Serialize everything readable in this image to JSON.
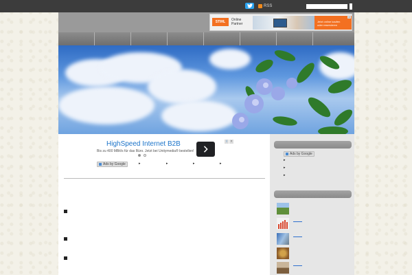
{
  "topbar": {
    "twitter_icon": "twitter-bird-icon",
    "rss_label": "RSS",
    "search_placeholder": "",
    "colors": {
      "bar": "#3c3c3c",
      "twitter": "#2aa3ef",
      "rss": "#f08a1c"
    }
  },
  "header_ad": {
    "brand": "STIHL",
    "line1": "Online",
    "line2": "Partner",
    "cta_line1": "Jetzt online kaufen",
    "cta_line2": "oder reservieren"
  },
  "nav": {
    "items": [
      "",
      "",
      "",
      "",
      "",
      "",
      "",
      ""
    ]
  },
  "content_ad": {
    "title": "HighSpeed Internet B2B",
    "description": "Bis zu 400 MBit/s für das Büro. Jetzt bei Unitymedia® bestellen!",
    "choices_icon": "adchoices-icon",
    "close_icon": "close-icon",
    "dots": 2,
    "active_dot": 0
  },
  "ads_by_google": {
    "label": "Ads by Google"
  },
  "sidebar": {
    "ads_label": "Ads by Google",
    "thumbnails": [
      "landscape-thumb",
      "chart-thumb",
      "building-thumb",
      "food-thumb",
      "house-thumb"
    ]
  }
}
